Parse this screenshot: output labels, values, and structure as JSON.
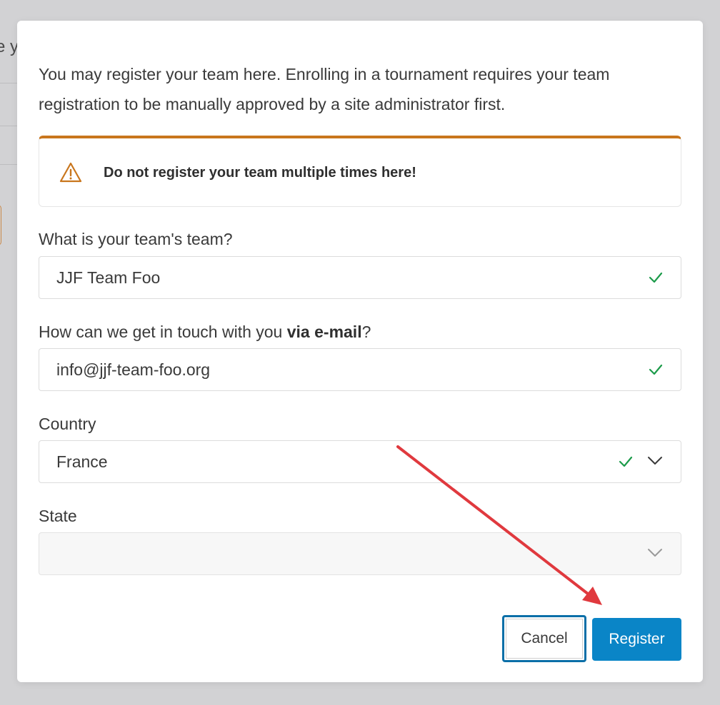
{
  "background": {
    "peek_text": "e y"
  },
  "modal": {
    "intro": [
      "You may register your team here. Enrolling in a tournament requires your team",
      "registration to be manually approved by a site administrator first."
    ],
    "warning": {
      "icon": "warning-triangle-icon",
      "text": "Do not register your team multiple times here!",
      "accent_color": "#c9761d"
    },
    "team": {
      "label": "What is your team's team?",
      "value": "JJF Team Foo"
    },
    "email": {
      "label_prefix": "How can we get in touch with you ",
      "label_bold": "via e-mail",
      "label_suffix": "?",
      "value": "info@jjf-team-foo.org"
    },
    "country": {
      "label": "Country",
      "value": "France"
    },
    "state": {
      "label": "State",
      "value": ""
    },
    "buttons": {
      "cancel": "Cancel",
      "register": "Register"
    }
  },
  "colors": {
    "valid": "#1c9b4a",
    "primary": "#0a85c7",
    "annotation_arrow": "#e0393e"
  }
}
